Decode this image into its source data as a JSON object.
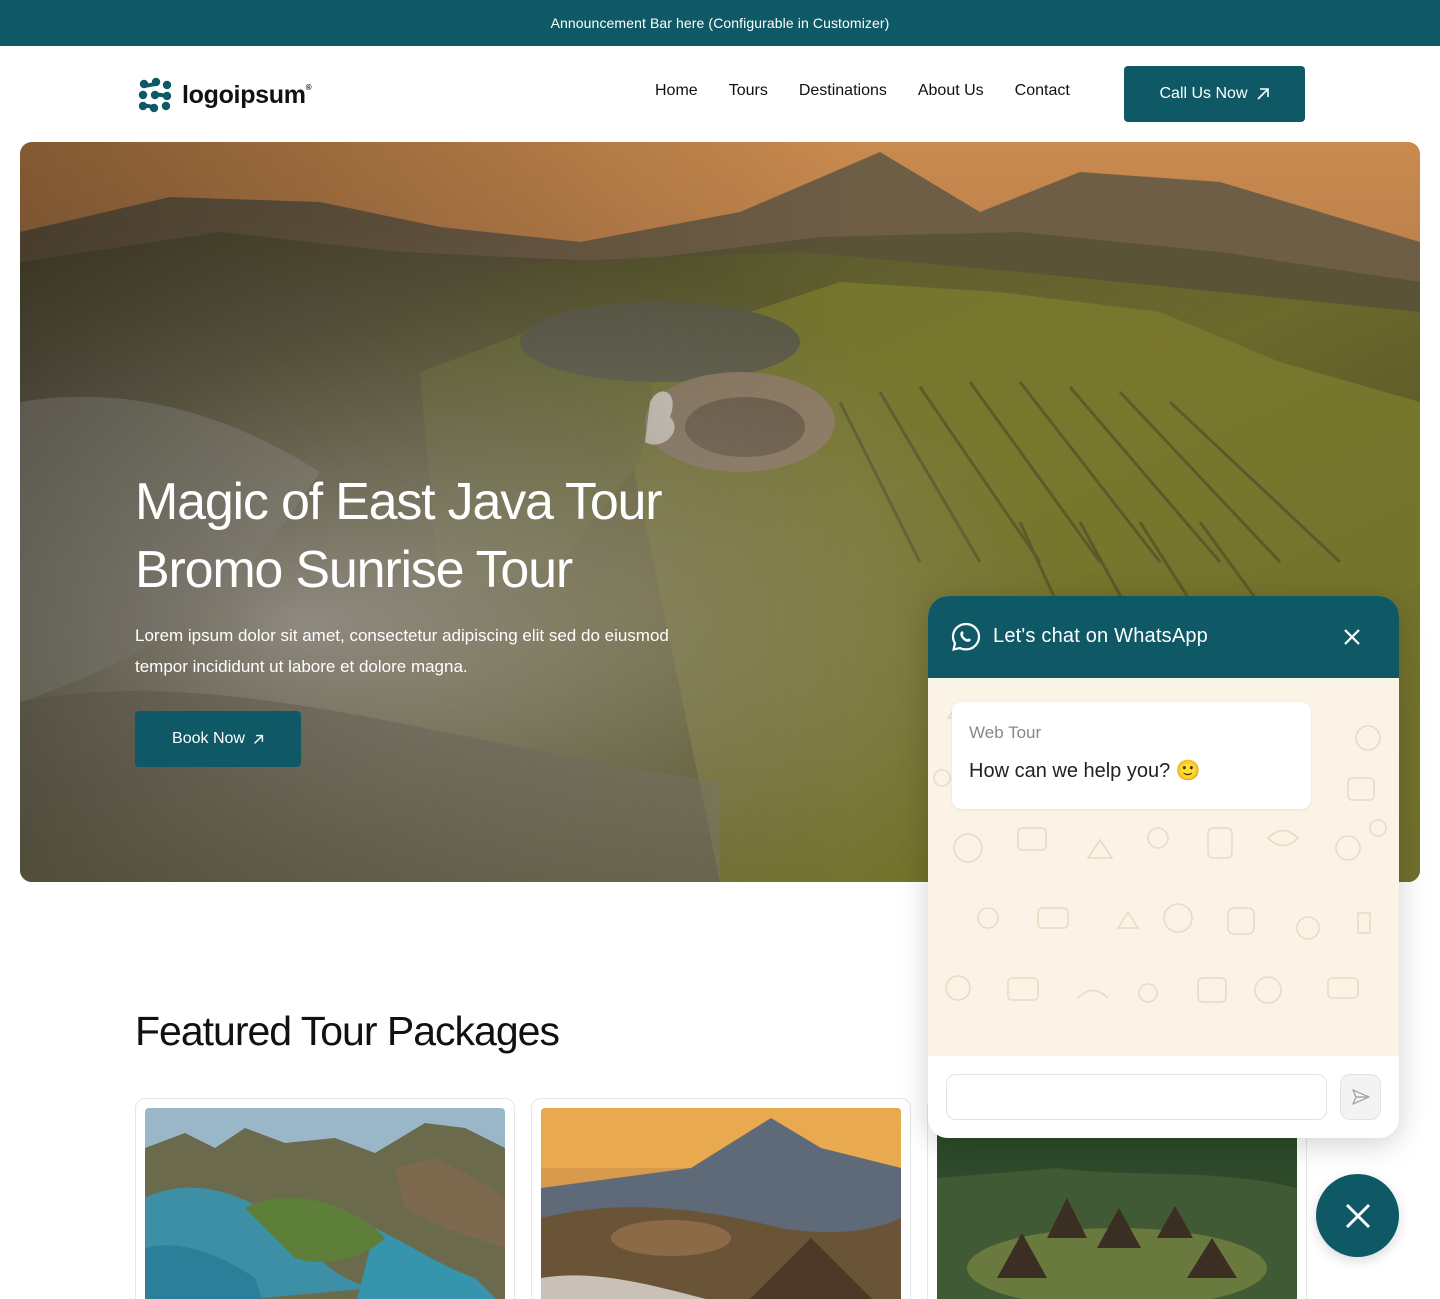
{
  "announcement": {
    "text": "Announcement Bar here (Configurable in Customizer)"
  },
  "brand": {
    "name": "logoipsum",
    "mark": "®",
    "accent": "#0e5965"
  },
  "nav": {
    "items": [
      "Home",
      "Tours",
      "Destinations",
      "About Us",
      "Contact"
    ],
    "cta_label": "Call Us Now",
    "cta_icon": "arrow-up-right-icon"
  },
  "hero": {
    "title_line1": "Magic of East Java Tour",
    "title_line2": "Bromo Sunrise Tour",
    "description": "Lorem ipsum dolor sit amet, consectetur adipiscing elit sed do eiusmod tempor incididunt ut labore et dolore magna.",
    "button_label": "Book Now",
    "image": "volcano-landscape-photo"
  },
  "featured": {
    "title": "Featured Tour Packages",
    "cards": [
      {
        "image": "island-bay-photo"
      },
      {
        "image": "volcano-sunrise-photo"
      },
      {
        "image": "village-huts-photo"
      }
    ]
  },
  "whatsapp": {
    "header_title": "Let's chat on WhatsApp",
    "header_icon": "whatsapp-icon",
    "close_icon": "close-icon",
    "sender_name": "Web Tour",
    "message": "How can we help you? 🙂",
    "input_placeholder": "",
    "send_icon": "send-icon",
    "fab_icon": "close-icon"
  }
}
